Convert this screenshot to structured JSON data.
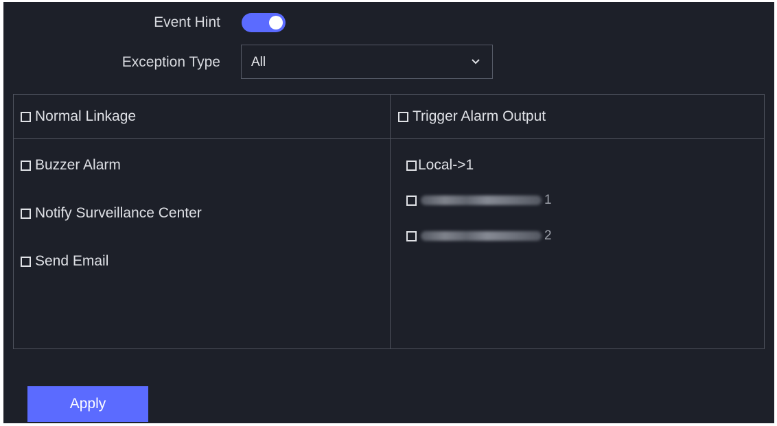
{
  "event_hint": {
    "label": "Event Hint",
    "enabled": true
  },
  "exception_type": {
    "label": "Exception Type",
    "value": "All"
  },
  "normal_linkage": {
    "header": "Normal Linkage",
    "items": [
      {
        "label": "Buzzer Alarm",
        "checked": false
      },
      {
        "label": "Notify Surveillance Center",
        "checked": false
      },
      {
        "label": "Send Email",
        "checked": false
      }
    ]
  },
  "trigger_alarm_output": {
    "header": "Trigger Alarm Output",
    "items": [
      {
        "label": "Local->1",
        "checked": false
      },
      {
        "label": "1",
        "checked": false,
        "obscured": true
      },
      {
        "label": "2",
        "checked": false,
        "obscured": true
      }
    ]
  },
  "apply_button": {
    "label": "Apply",
    "color": "#5b6bff"
  },
  "colors": {
    "background": "#1d2029",
    "accent": "#5b6bff",
    "border": "#4e525d",
    "text": "#dfe1e6"
  },
  "icons": {
    "dropdown": "chevron-down-icon",
    "checkbox": "checkbox-empty-icon"
  }
}
